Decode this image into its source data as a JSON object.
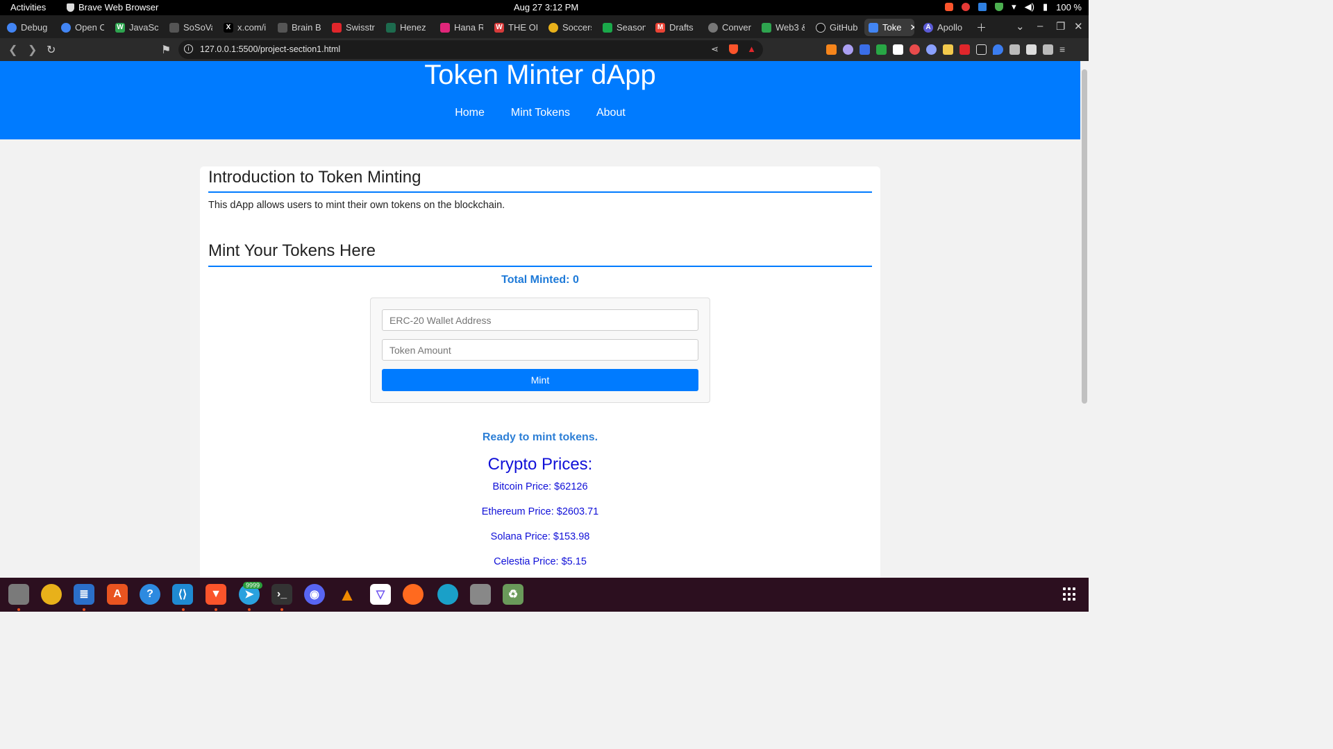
{
  "system": {
    "activities": "Activities",
    "app_name": "Brave Web Browser",
    "clock": "Aug 27  3:12 PM",
    "battery": "100 %"
  },
  "tabs": [
    {
      "label": "Debug",
      "icon_color": "#4285f4"
    },
    {
      "label": "Open C",
      "icon_color": "#4285f4"
    },
    {
      "label": "JavaScr",
      "icon_color": "#2ea44f"
    },
    {
      "label": "SoSoVa",
      "icon_color": "#555555"
    },
    {
      "label": "x.com/i",
      "icon_color": "#000000"
    },
    {
      "label": "Brain B",
      "icon_color": "#555555"
    },
    {
      "label": "Swisstr",
      "icon_color": "#e0262b"
    },
    {
      "label": "Henez",
      "icon_color": "#1d6b4e"
    },
    {
      "label": "Hana R",
      "icon_color": "#e0267a"
    },
    {
      "label": "THE OD",
      "icon_color": "#d83b3b"
    },
    {
      "label": "Soccers",
      "icon_color": "#e8b11a"
    },
    {
      "label": "Season",
      "icon_color": "#1aa84a"
    },
    {
      "label": "Drafts",
      "icon_color": "#ea4335"
    },
    {
      "label": "Conver",
      "icon_color": "#777777"
    },
    {
      "label": "Web3 &",
      "icon_color": "#2ea44f"
    },
    {
      "label": "GitHub",
      "icon_color": "#111111"
    },
    {
      "label": "Toke",
      "icon_color": "#4285f4"
    },
    {
      "label": "Apollo",
      "icon_color": "#5b5bd6"
    }
  ],
  "browser": {
    "url": "127.0.0.1:5500/project-section1.html"
  },
  "page": {
    "header_title": "Token Minter dApp",
    "nav": [
      "Home",
      "Mint Tokens",
      "About"
    ],
    "intro_title": "Introduction to Token Minting",
    "intro_text": "This dApp allows users to mint their own tokens on the blockchain.",
    "mint_title": "Mint Your Tokens Here",
    "total_minted": "Total Minted: 0",
    "wallet_placeholder": "ERC-20 Wallet Address",
    "amount_placeholder": "Token Amount",
    "mint_button": "Mint",
    "status": "Ready to mint tokens.",
    "prices_title": "Crypto Prices:",
    "prices": [
      "Bitcoin Price: $62126",
      "Ethereum Price: $2603.71",
      "Solana Price: $153.98",
      "Celestia Price: $5.15"
    ]
  },
  "dock": {
    "telegram_badge": "9999",
    "apps": [
      {
        "name": "files",
        "color": "#7a7a7a"
      },
      {
        "name": "rhythmbox",
        "color": "#e8b11a"
      },
      {
        "name": "writer",
        "color": "#2b6fc9"
      },
      {
        "name": "app-center",
        "color": "#e95420"
      },
      {
        "name": "help",
        "color": "#2d8ae0"
      },
      {
        "name": "vscode",
        "color": "#1f8ad2"
      },
      {
        "name": "brave",
        "color": "#fb542b"
      },
      {
        "name": "telegram",
        "color": "#2aa1de"
      },
      {
        "name": "terminal",
        "color": "#333333"
      },
      {
        "name": "discord",
        "color": "#5865f2"
      },
      {
        "name": "vlc",
        "color": "#f08a00"
      },
      {
        "name": "proton-vpn",
        "color": "#ffffff"
      },
      {
        "name": "firefox",
        "color": "#ff6a1f"
      },
      {
        "name": "edge",
        "color": "#1aa0c8"
      },
      {
        "name": "archive",
        "color": "#888888"
      },
      {
        "name": "trash",
        "color": "#6a9a5a"
      }
    ]
  }
}
